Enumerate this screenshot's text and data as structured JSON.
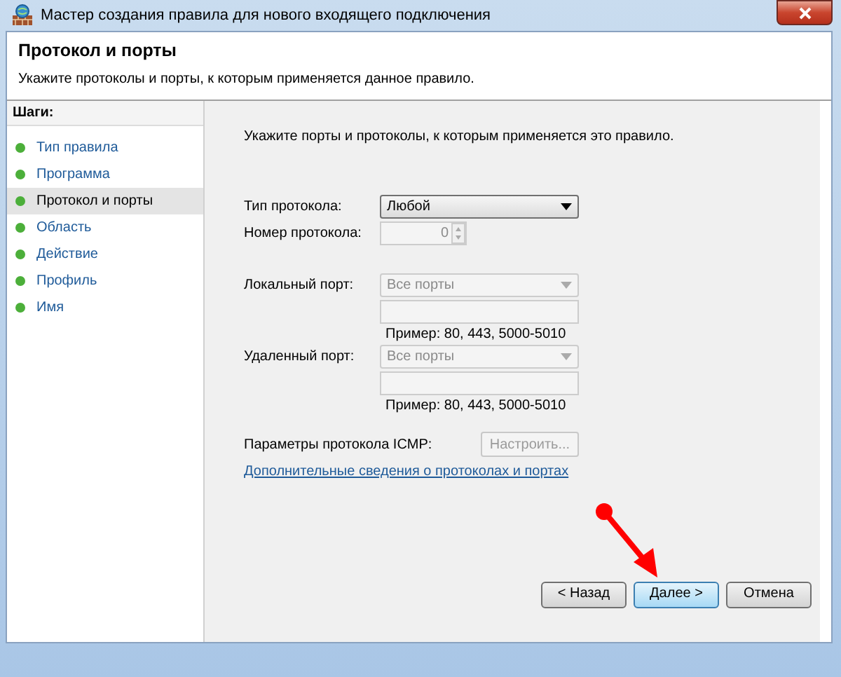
{
  "window": {
    "title": "Мастер создания правила для нового входящего подключения"
  },
  "header": {
    "title": "Протокол и порты",
    "subtitle": "Укажите протоколы и порты, к которым применяется данное правило."
  },
  "steps": {
    "title": "Шаги:",
    "items": [
      {
        "label": "Тип правила",
        "selected": false
      },
      {
        "label": "Программа",
        "selected": false
      },
      {
        "label": "Протокол и порты",
        "selected": true
      },
      {
        "label": "Область",
        "selected": false
      },
      {
        "label": "Действие",
        "selected": false
      },
      {
        "label": "Профиль",
        "selected": false
      },
      {
        "label": "Имя",
        "selected": false
      }
    ]
  },
  "prompt": "Укажите порты и протоколы, к которым применяется это правило.",
  "protocol_type": {
    "label": "Тип протокола:",
    "value": "Любой",
    "disabled": false
  },
  "protocol_number": {
    "label": "Номер протокола:",
    "value": "0",
    "disabled": true
  },
  "local_port": {
    "label": "Локальный порт:",
    "value": "Все порты",
    "disabled": true,
    "example": "Пример: 80, 443, 5000-5010"
  },
  "remote_port": {
    "label": "Удаленный порт:",
    "value": "Все порты",
    "disabled": true,
    "example": "Пример: 80, 443, 5000-5010"
  },
  "icmp": {
    "label": "Параметры протокола ICMP:",
    "button": "Настроить...",
    "disabled": true
  },
  "link": "Дополнительные сведения о протоколах и портах",
  "buttons": [
    {
      "label": "< Назад",
      "default": false
    },
    {
      "label": "Далее >",
      "default": true
    },
    {
      "label": "Отмена",
      "default": false
    }
  ]
}
